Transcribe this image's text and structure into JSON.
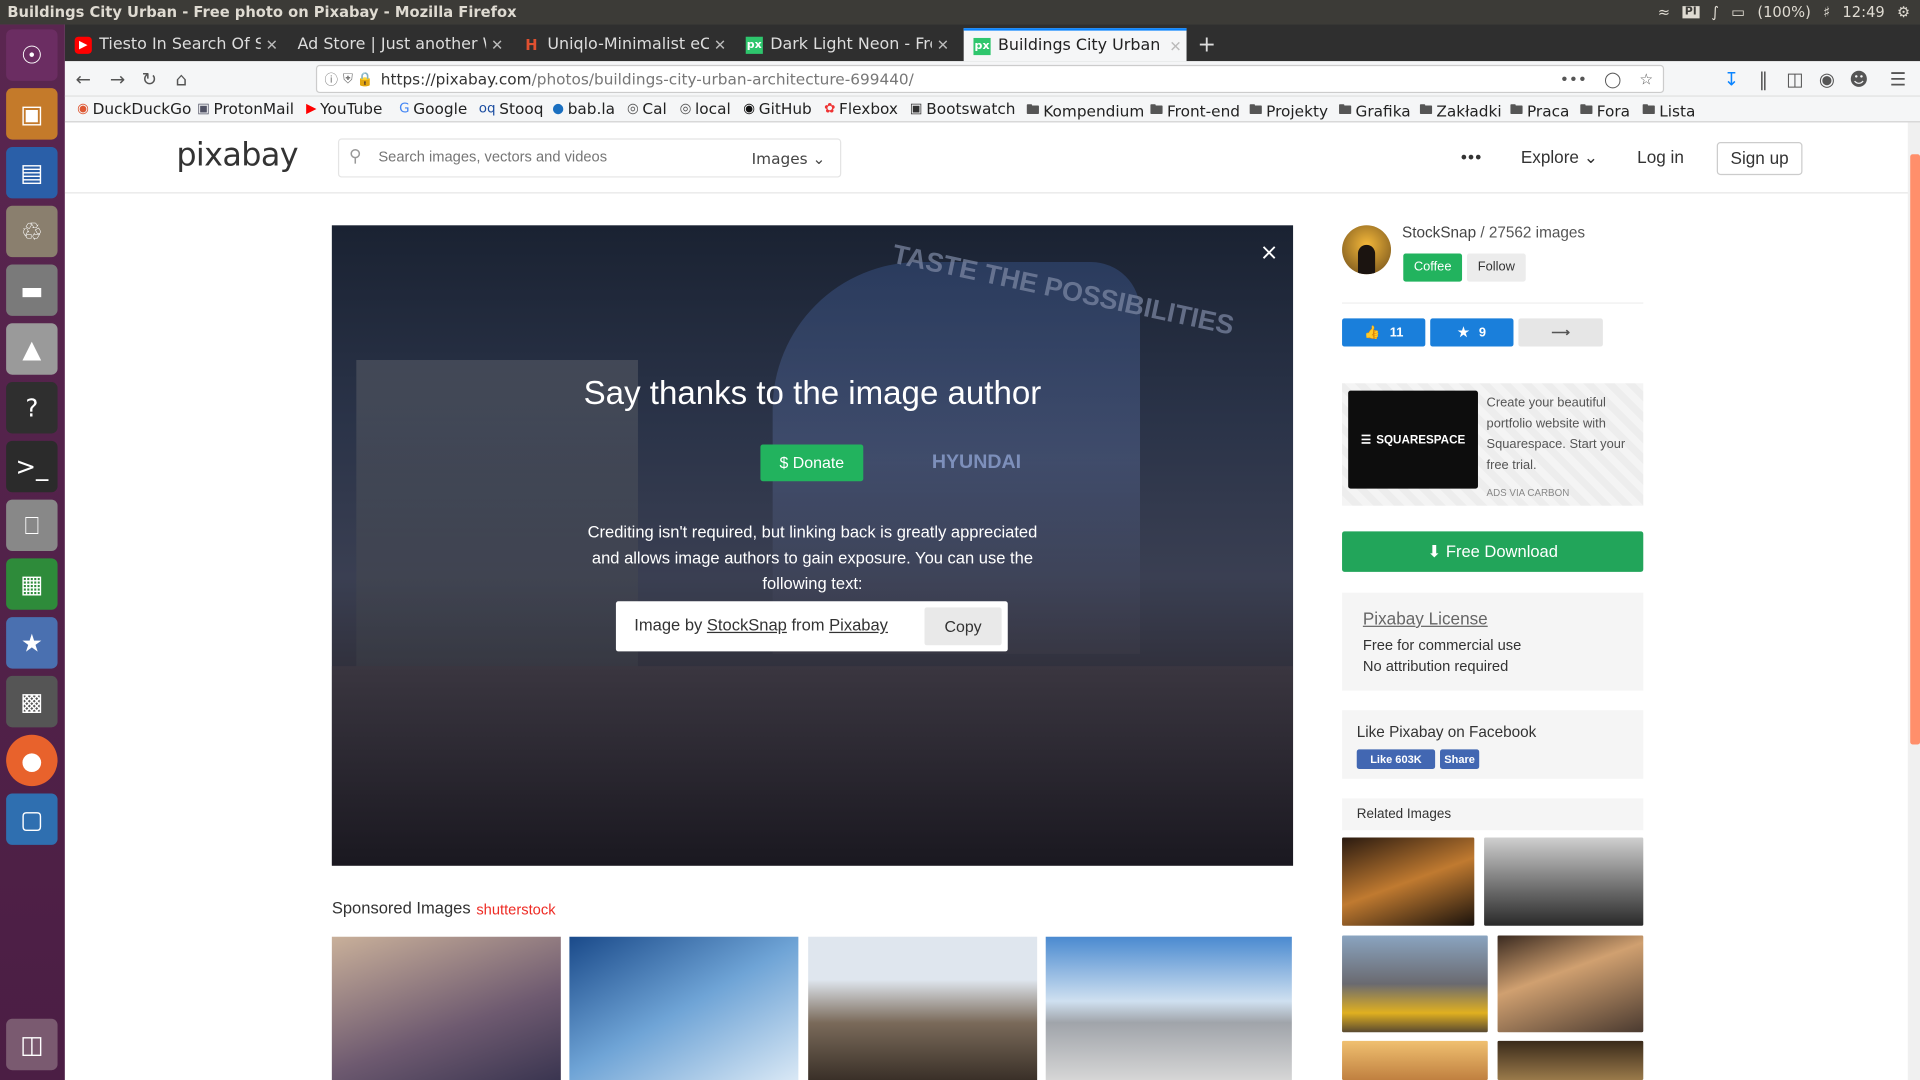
{
  "system": {
    "window_title": "Buildings City Urban - Free photo on Pixabay - Mozilla Firefox",
    "keyboard_layout": "Pl",
    "battery": "(100%)",
    "clock": "12:49"
  },
  "tabs": [
    {
      "label": "Tiesto In Search Of Su",
      "favicon": "youtube",
      "color": "#ff0000"
    },
    {
      "label": "Ad Store | Just another Wo",
      "favicon": "none",
      "color": "#2f2f2f"
    },
    {
      "label": "Uniqlo-Minimalist eCom",
      "favicon": "h",
      "color": "#e05030"
    },
    {
      "label": "Dark Light Neon - Free p",
      "favicon": "px",
      "color": "#2ec66d"
    },
    {
      "label": "Buildings City Urban - Fr",
      "favicon": "px",
      "color": "#2ec66d"
    }
  ],
  "url": {
    "prefix": "https://pixabay.com",
    "path": "/photos/buildings-city-urban-architecture-699440/"
  },
  "bookmarks": [
    "DuckDuckGo",
    "ProtonMail",
    "YouTube",
    "Google",
    "Stooq",
    "bab.la",
    "Cal",
    "local",
    "GitHub",
    "Flexbox",
    "Bootswatch",
    "Kompendium",
    "Front-end",
    "Projekty",
    "Grafika",
    "Zakładki",
    "Praca",
    "Fora",
    "Lista"
  ],
  "header": {
    "logo": "pixabay",
    "search_placeholder": "Search images, vectors and videos",
    "search_type": "Images",
    "more": "•••",
    "explore": "Explore",
    "login": "Log in",
    "signup": "Sign up"
  },
  "modal": {
    "heading": "Say thanks to the image author",
    "donate": "$ Donate",
    "credit_text": "Crediting isn't required, but linking back is greatly appreciated and allows image authors to gain exposure. You can use the following text:",
    "attr_prefix": "Image by",
    "attr_author": "StockSnap",
    "attr_from": "from",
    "attr_site": "Pixabay",
    "copy": "Copy",
    "photo_sign1": "TASTE THE POSSIBILITIES",
    "photo_sign2": "HYUNDAI",
    "close": "×"
  },
  "sponsored": {
    "label": "Sponsored Images",
    "brand": "shutterstock"
  },
  "sidebar": {
    "author_name": "StockSnap",
    "author_sep": " / ",
    "author_count": "27562 images",
    "coffee": "Coffee",
    "follow": "Follow",
    "likes": "11",
    "favorites": "9",
    "ad": {
      "brand": "SQUARESPACE",
      "text": "Create your beautiful portfolio website with Squarespace. Start your free trial.",
      "via": "ADS VIA CARBON"
    },
    "download": "Free Download",
    "license": {
      "title": "Pixabay License",
      "line1": "Free for commercial use",
      "line2": "No attribution required"
    },
    "facebook": {
      "title": "Like Pixabay on Facebook",
      "like": "Like 603K",
      "share": "Share"
    },
    "related": "Related Images"
  },
  "colors": {
    "accent_green": "#22b35e",
    "like_blue": "#1a7fdb",
    "fb_blue": "#4267b2",
    "shutter_red": "#ee2b24"
  }
}
